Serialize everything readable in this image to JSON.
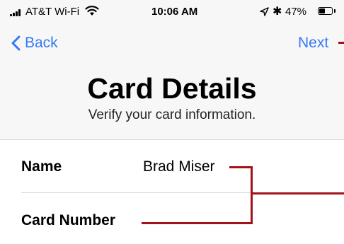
{
  "status_bar": {
    "carrier": "AT&T Wi-Fi",
    "time": "10:06 AM",
    "bluetooth": "✱",
    "battery_percent": "47%",
    "icons": [
      "signal-icon",
      "wifi-icon",
      "location-arrow-icon",
      "bluetooth-icon",
      "battery-icon"
    ]
  },
  "nav": {
    "back_label": "Back",
    "next_label": "Next"
  },
  "header": {
    "title": "Card Details",
    "subtitle": "Verify your card information."
  },
  "form": {
    "name_label": "Name",
    "name_value": "Brad Miser",
    "card_number_label": "Card Number"
  },
  "colors": {
    "accent": "#3478f6",
    "callout": "#a11219",
    "nav_background": "#f7f7f7"
  }
}
